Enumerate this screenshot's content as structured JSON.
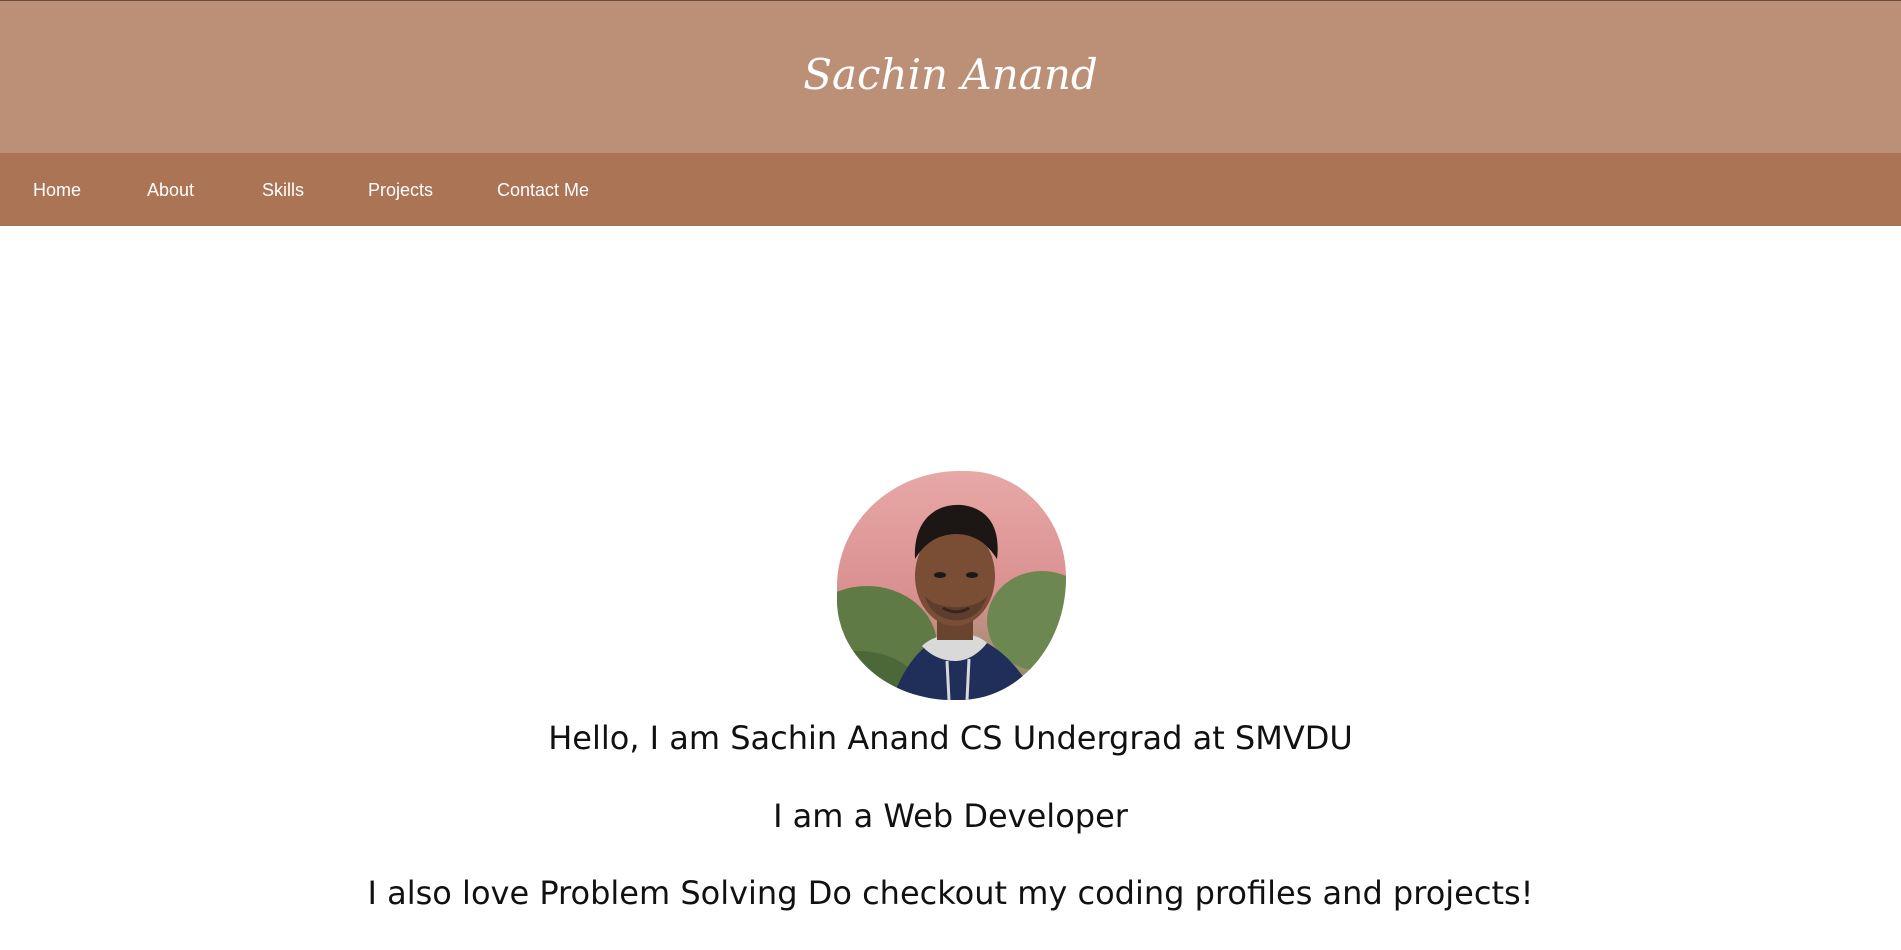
{
  "header": {
    "title": "Sachin Anand"
  },
  "nav": {
    "items": [
      {
        "label": "Home"
      },
      {
        "label": "About"
      },
      {
        "label": "Skills"
      },
      {
        "label": "Projects"
      },
      {
        "label": "Contact Me"
      }
    ]
  },
  "hero": {
    "avatar_icon": "profile-photo",
    "lines": [
      "Hello, I am Sachin Anand CS Undergrad at SMVDU",
      "I am a Web Developer",
      "I also love Problem Solving Do checkout my coding profiles and projects!"
    ]
  },
  "colors": {
    "header_bg": "#bc8f77",
    "nav_bg": "#ab7455",
    "text_light": "#ffffff",
    "text_dark": "#111111"
  }
}
